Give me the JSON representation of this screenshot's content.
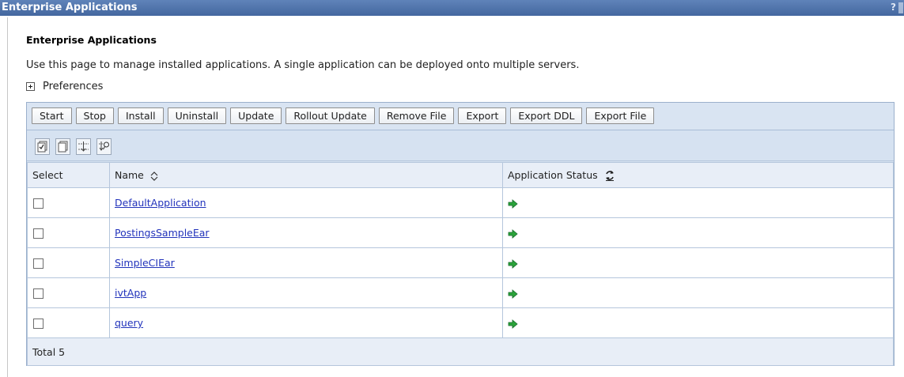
{
  "titlebar": {
    "title": "Enterprise Applications",
    "help": "?"
  },
  "heading": "Enterprise Applications",
  "description": "Use this page to manage installed applications. A single application can be deployed onto multiple servers.",
  "preferences": {
    "label": "Preferences",
    "icon": "expand-plus-icon"
  },
  "buttons": [
    {
      "label": "Start"
    },
    {
      "label": "Stop"
    },
    {
      "label": "Install"
    },
    {
      "label": "Uninstall"
    },
    {
      "label": "Update"
    },
    {
      "label": "Rollout Update"
    },
    {
      "label": "Remove File"
    },
    {
      "label": "Export"
    },
    {
      "label": "Export DDL"
    },
    {
      "label": "Export File"
    }
  ],
  "tools": [
    {
      "icon": "select-all-icon"
    },
    {
      "icon": "deselect-all-icon"
    },
    {
      "icon": "show-filter-icon"
    },
    {
      "icon": "clear-filter-icon"
    }
  ],
  "table": {
    "headers": {
      "select": "Select",
      "name": "Name",
      "status": "Application Status"
    },
    "rows": [
      {
        "name": "DefaultApplication",
        "status_icon": "started-arrow-icon"
      },
      {
        "name": "PostingsSampleEar",
        "status_icon": "started-arrow-icon"
      },
      {
        "name": "SimpleCIEar",
        "status_icon": "started-arrow-icon"
      },
      {
        "name": "ivtApp",
        "status_icon": "started-arrow-icon"
      },
      {
        "name": "query",
        "status_icon": "started-arrow-icon"
      }
    ],
    "total": "Total 5"
  },
  "colors": {
    "titlebar": "#4d6fa7",
    "panel": "#d6e2f1",
    "link": "#2233bb",
    "started": "#2aa33a"
  }
}
